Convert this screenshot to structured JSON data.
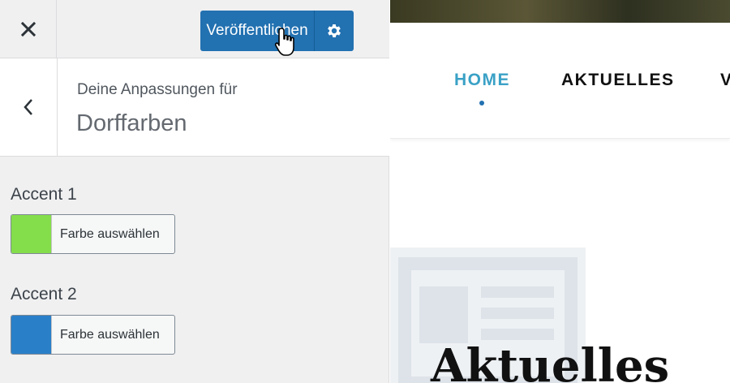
{
  "customizer": {
    "publish_label": "Veröffentlichen",
    "subtitle": "Deine Anpassungen für",
    "title": "Dorffarben",
    "controls": [
      {
        "label": "Accent 1",
        "button_label": "Farbe auswählen",
        "color": "#84dd4b"
      },
      {
        "label": "Accent 2",
        "button_label": "Farbe auswählen",
        "color": "#2a7fc9"
      }
    ]
  },
  "preview": {
    "nav": [
      "HOME",
      "AKTUELLES",
      "V"
    ],
    "heading": "Aktuelles"
  },
  "colors": {
    "publish": "#2271b1",
    "nav_active": "#3aa1c6"
  }
}
